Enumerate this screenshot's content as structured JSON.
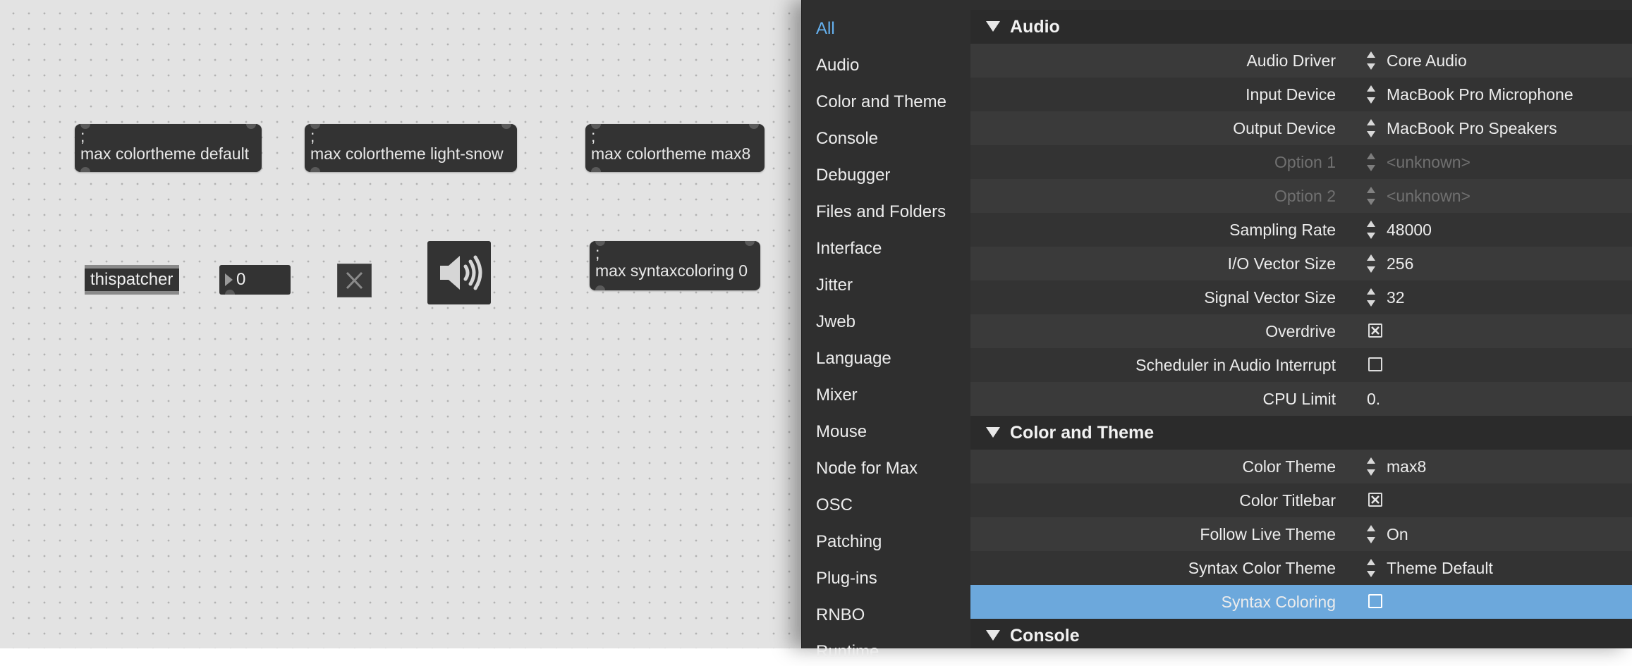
{
  "patcher": {
    "messages": [
      {
        "line1": ";",
        "line2": "max colortheme default"
      },
      {
        "line1": ";",
        "line2": "max colortheme light-snow"
      },
      {
        "line1": ";",
        "line2": "max colortheme max8"
      },
      {
        "line1": ";",
        "line2": "max syntaxcoloring 0"
      }
    ],
    "thispatcher_label": "thispatcher",
    "number_value": "0"
  },
  "sidebar": {
    "items": [
      {
        "label": "All"
      },
      {
        "label": "Audio"
      },
      {
        "label": "Color and Theme"
      },
      {
        "label": "Console"
      },
      {
        "label": "Debugger"
      },
      {
        "label": "Files and Folders"
      },
      {
        "label": "Interface"
      },
      {
        "label": "Jitter"
      },
      {
        "label": "Jweb"
      },
      {
        "label": "Language"
      },
      {
        "label": "Mixer"
      },
      {
        "label": "Mouse"
      },
      {
        "label": "Node for Max"
      },
      {
        "label": "OSC"
      },
      {
        "label": "Patching"
      },
      {
        "label": "Plug-ins"
      },
      {
        "label": "RNBO"
      },
      {
        "label": "Runtime"
      }
    ],
    "selected": "All"
  },
  "properties": {
    "audio": {
      "title": "Audio",
      "rows": [
        {
          "label": "Audio Driver",
          "value": "Core Audio"
        },
        {
          "label": "Input Device",
          "value": "MacBook Pro Microphone"
        },
        {
          "label": "Output Device",
          "value": "MacBook Pro Speakers"
        },
        {
          "label": "Option 1",
          "value": "<unknown>"
        },
        {
          "label": "Option 2",
          "value": "<unknown>"
        },
        {
          "label": "Sampling Rate",
          "value": "48000"
        },
        {
          "label": "I/O Vector Size",
          "value": "256"
        },
        {
          "label": "Signal Vector Size",
          "value": "32"
        },
        {
          "label": "Overdrive",
          "checked": true
        },
        {
          "label": "Scheduler in Audio Interrupt",
          "checked": false
        },
        {
          "label": "CPU Limit",
          "value": "0."
        }
      ]
    },
    "color_theme": {
      "title": "Color and Theme",
      "rows": [
        {
          "label": "Color Theme",
          "value": "max8"
        },
        {
          "label": "Color Titlebar",
          "checked": true
        },
        {
          "label": "Follow Live Theme",
          "value": "On"
        },
        {
          "label": "Syntax Color Theme",
          "value": "Theme Default"
        },
        {
          "label": "Syntax Coloring",
          "checked": false
        }
      ]
    },
    "console": {
      "title": "Console"
    }
  },
  "colors": {
    "accent": "#65b0ee",
    "selected_row": "#6ca8dc",
    "object_bg": "#333333",
    "canvas_bg": "#e3e3e3"
  },
  "icons": {
    "speaker": "speaker-icon",
    "close": "close-icon",
    "disclosure": "triangle-down-icon",
    "stepper": "up-down-arrows-icon"
  }
}
